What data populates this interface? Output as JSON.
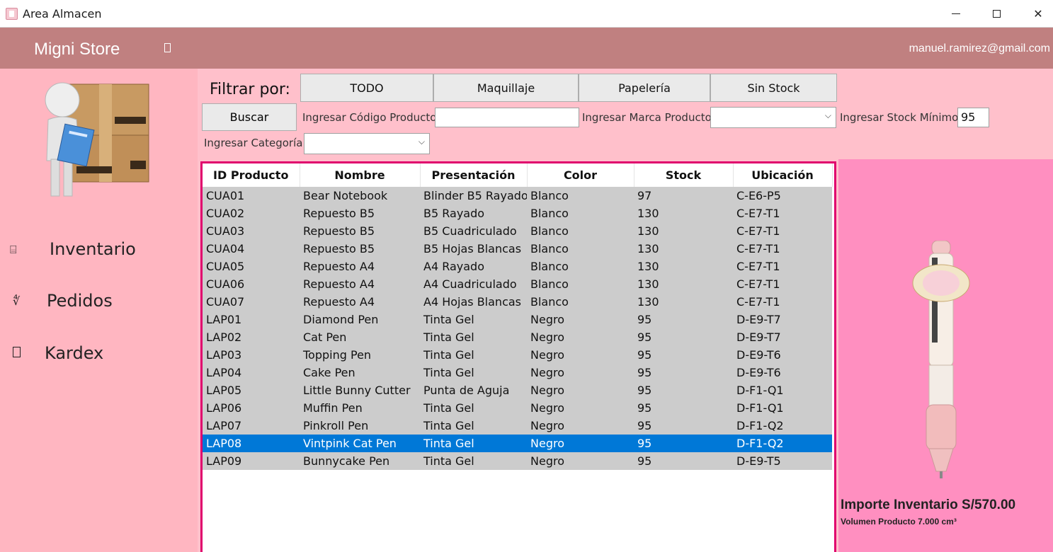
{
  "window": {
    "title": "Area Almacen"
  },
  "header": {
    "brand": "Migni Store",
    "user_email": "manuel.ramirez@gmail.com"
  },
  "sidebar": {
    "items": [
      {
        "label": "Inventario",
        "icon": "inventory-icon"
      },
      {
        "label": "Pedidos",
        "icon": "orders-icon"
      },
      {
        "label": "Kardex",
        "icon": "kardex-icon"
      }
    ]
  },
  "filters": {
    "title": "Filtrar por:",
    "buttons": [
      "TODO",
      "Maquillaje",
      "Papelería",
      "Sin Stock"
    ],
    "search_button": "Buscar",
    "codigo_label": "Ingresar Código Producto",
    "codigo_value": "",
    "marca_label": "Ingresar Marca Producto",
    "marca_value": "",
    "stock_label": "Ingresar Stock Mínimo",
    "stock_value": "95",
    "categoria_label": "Ingresar Categoría",
    "categoria_value": ""
  },
  "table": {
    "columns": [
      "ID Producto",
      "Nombre",
      "Presentación",
      "Color",
      "Stock",
      "Ubicación"
    ],
    "rows": [
      [
        "CUA01",
        "Bear Notebook",
        "Blinder B5 Rayado",
        "Blanco",
        "97",
        "C-E6-P5"
      ],
      [
        "CUA02",
        "Repuesto B5",
        "B5 Rayado",
        "Blanco",
        "130",
        "C-E7-T1"
      ],
      [
        "CUA03",
        "Repuesto B5",
        "B5 Cuadriculado",
        "Blanco",
        "130",
        "C-E7-T1"
      ],
      [
        "CUA04",
        "Repuesto B5",
        "B5 Hojas Blancas",
        "Blanco",
        "130",
        "C-E7-T1"
      ],
      [
        "CUA05",
        "Repuesto A4",
        "A4 Rayado",
        "Blanco",
        "130",
        "C-E7-T1"
      ],
      [
        "CUA06",
        "Repuesto A4",
        "A4 Cuadriculado",
        "Blanco",
        "130",
        "C-E7-T1"
      ],
      [
        "CUA07",
        "Repuesto A4",
        "A4 Hojas Blancas",
        "Blanco",
        "130",
        "C-E7-T1"
      ],
      [
        "LAP01",
        "Diamond Pen",
        "Tinta Gel",
        "Negro",
        "95",
        "D-E9-T7"
      ],
      [
        "LAP02",
        "Cat Pen",
        "Tinta Gel",
        "Negro",
        "95",
        "D-E9-T7"
      ],
      [
        "LAP03",
        "Topping Pen",
        "Tinta Gel",
        "Negro",
        "95",
        "D-E9-T6"
      ],
      [
        "LAP04",
        "Cake Pen",
        "Tinta Gel",
        "Negro",
        "95",
        "D-E9-T6"
      ],
      [
        "LAP05",
        "Little Bunny Cutter",
        "Punta de Aguja",
        "Negro",
        "95",
        "D-F1-Q1"
      ],
      [
        "LAP06",
        "Muffin Pen",
        "Tinta Gel",
        "Negro",
        "95",
        "D-F1-Q1"
      ],
      [
        "LAP07",
        "Pinkroll Pen",
        "Tinta Gel",
        "Negro",
        "95",
        "D-F1-Q2"
      ],
      [
        "LAP08",
        "Vintpink Cat Pen",
        "Tinta Gel",
        "Negro",
        "95",
        "D-F1-Q2"
      ],
      [
        "LAP09",
        "Bunnycake Pen",
        "Tinta Gel",
        "Negro",
        "95",
        "D-E9-T5"
      ]
    ],
    "selected_row": 14
  },
  "preview": {
    "importe": "Importe Inventario S/570.00",
    "volumen": "Volumen Producto 7.000 cm³"
  },
  "colors": {
    "header": "#c08080",
    "sidebar": "#ffb6c1",
    "panel": "#ffc0cb",
    "table_border": "#e0006d",
    "preview": "#ff8fc0",
    "selection": "#0078d7"
  }
}
